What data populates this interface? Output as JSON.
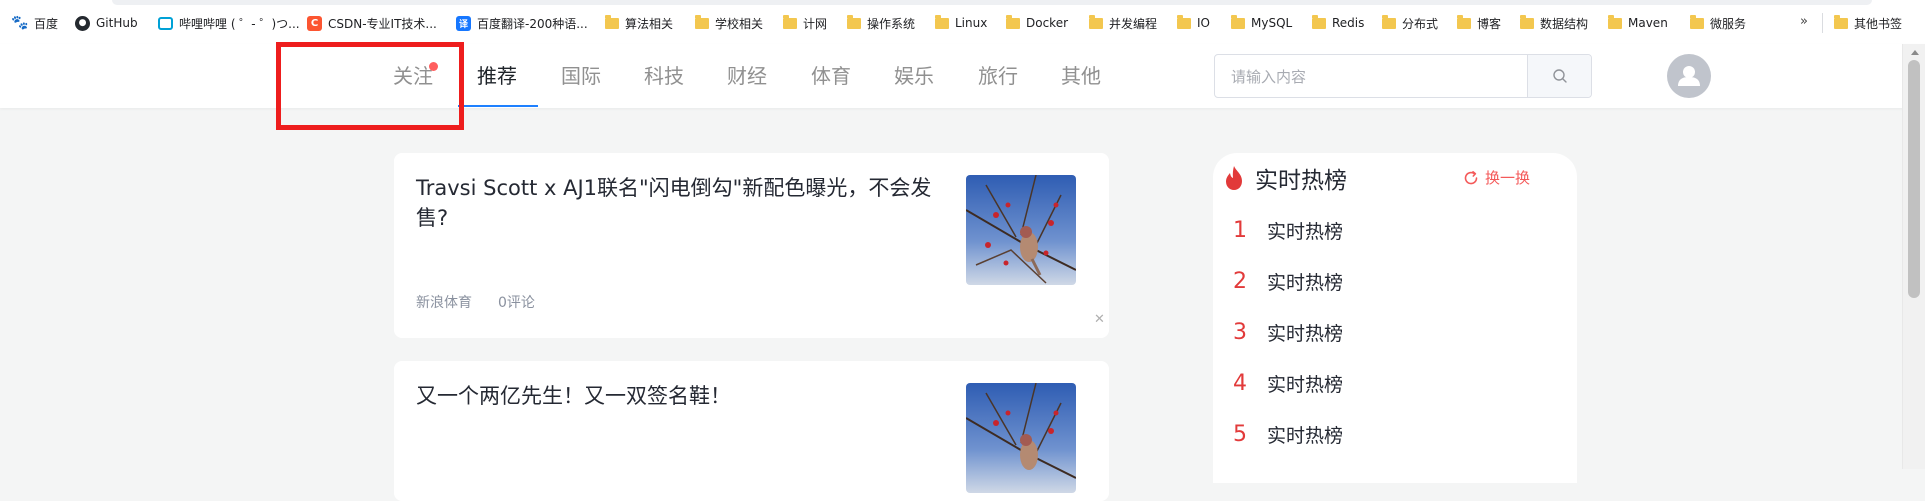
{
  "bookmarks": {
    "items": [
      {
        "label": "百度",
        "icon": "baidu-icon"
      },
      {
        "label": "GitHub",
        "icon": "github-icon"
      },
      {
        "label": "哔哩哔哩 ( ゜- ゜)つ...",
        "icon": "bilibili-icon"
      },
      {
        "label": "CSDN-专业IT技术...",
        "icon": "csdn-icon"
      },
      {
        "label": "百度翻译-200种语...",
        "icon": "translate-icon"
      },
      {
        "label": "算法相关",
        "icon": "folder-icon"
      },
      {
        "label": "学校相关",
        "icon": "folder-icon"
      },
      {
        "label": "计网",
        "icon": "folder-icon"
      },
      {
        "label": "操作系统",
        "icon": "folder-icon"
      },
      {
        "label": "Linux",
        "icon": "folder-icon"
      },
      {
        "label": "Docker",
        "icon": "folder-icon"
      },
      {
        "label": "并发编程",
        "icon": "folder-icon"
      },
      {
        "label": "IO",
        "icon": "folder-icon"
      },
      {
        "label": "MySQL",
        "icon": "folder-icon"
      },
      {
        "label": "Redis",
        "icon": "folder-icon"
      },
      {
        "label": "分布式",
        "icon": "folder-icon"
      },
      {
        "label": "博客",
        "icon": "folder-icon"
      },
      {
        "label": "数据结构",
        "icon": "folder-icon"
      },
      {
        "label": "Maven",
        "icon": "folder-icon"
      },
      {
        "label": "微服务",
        "icon": "folder-icon"
      }
    ],
    "overflow_label": "»",
    "other_label": "其他书签"
  },
  "nav": {
    "items": [
      {
        "label": "关注"
      },
      {
        "label": "推荐"
      },
      {
        "label": "国际"
      },
      {
        "label": "科技"
      },
      {
        "label": "财经"
      },
      {
        "label": "体育"
      },
      {
        "label": "娱乐"
      },
      {
        "label": "旅行"
      },
      {
        "label": "其他"
      }
    ],
    "active": "推荐",
    "accent_color": "#1e80ff",
    "badge_color": "#ff5e5e"
  },
  "search": {
    "placeholder": "请输入内容",
    "value": "",
    "icon": "search-icon"
  },
  "user": {
    "avatar_icon": "user-icon"
  },
  "articles": [
    {
      "title": "Travsi Scott x AJ1联名\"闪电倒勾\"新配色曝光，不会发售?",
      "source": "新浪体育",
      "comments": "0评论",
      "thumbnail": "bird-on-branch-image"
    },
    {
      "title": "又一个两亿先生！又一双签名鞋！",
      "thumbnail": "bird-on-branch-image"
    }
  ],
  "hot_list": {
    "title": "实时热榜",
    "refresh_label": "换一换",
    "accent_color": "#e23a3a",
    "items": [
      {
        "rank": "1",
        "text": "实时热榜"
      },
      {
        "rank": "2",
        "text": "实时热榜"
      },
      {
        "rank": "3",
        "text": "实时热榜"
      },
      {
        "rank": "4",
        "text": "实时热榜"
      },
      {
        "rank": "5",
        "text": "实时热榜"
      }
    ]
  },
  "annotation": {
    "color": "#ee1d1d"
  }
}
